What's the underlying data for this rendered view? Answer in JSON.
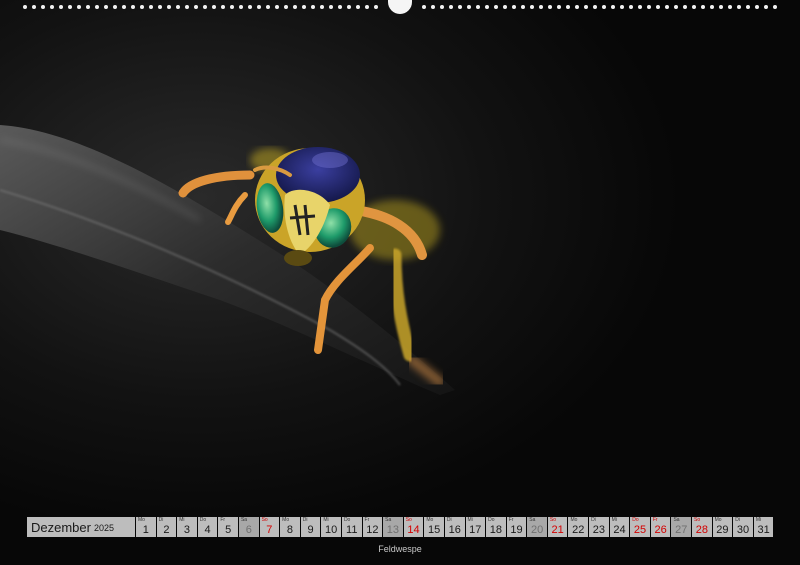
{
  "calendar": {
    "month": "Dezember",
    "year": "2025",
    "caption": "Feldwespe",
    "days": [
      {
        "wd": "Mo",
        "n": "1",
        "t": "w"
      },
      {
        "wd": "Di",
        "n": "2",
        "t": "w"
      },
      {
        "wd": "Mi",
        "n": "3",
        "t": "w"
      },
      {
        "wd": "Do",
        "n": "4",
        "t": "w"
      },
      {
        "wd": "Fr",
        "n": "5",
        "t": "w"
      },
      {
        "wd": "Sa",
        "n": "6",
        "t": "sat"
      },
      {
        "wd": "So",
        "n": "7",
        "t": "sun"
      },
      {
        "wd": "Mo",
        "n": "8",
        "t": "w"
      },
      {
        "wd": "Di",
        "n": "9",
        "t": "w"
      },
      {
        "wd": "Mi",
        "n": "10",
        "t": "w"
      },
      {
        "wd": "Do",
        "n": "11",
        "t": "w"
      },
      {
        "wd": "Fr",
        "n": "12",
        "t": "w"
      },
      {
        "wd": "Sa",
        "n": "13",
        "t": "sat"
      },
      {
        "wd": "So",
        "n": "14",
        "t": "sun"
      },
      {
        "wd": "Mo",
        "n": "15",
        "t": "w"
      },
      {
        "wd": "Di",
        "n": "16",
        "t": "w"
      },
      {
        "wd": "Mi",
        "n": "17",
        "t": "w"
      },
      {
        "wd": "Do",
        "n": "18",
        "t": "w"
      },
      {
        "wd": "Fr",
        "n": "19",
        "t": "w"
      },
      {
        "wd": "Sa",
        "n": "20",
        "t": "sat"
      },
      {
        "wd": "So",
        "n": "21",
        "t": "sun"
      },
      {
        "wd": "Mo",
        "n": "22",
        "t": "w"
      },
      {
        "wd": "Di",
        "n": "23",
        "t": "w"
      },
      {
        "wd": "Mi",
        "n": "24",
        "t": "w"
      },
      {
        "wd": "Do",
        "n": "25",
        "t": "hol"
      },
      {
        "wd": "Fr",
        "n": "26",
        "t": "hol"
      },
      {
        "wd": "Sa",
        "n": "27",
        "t": "sat"
      },
      {
        "wd": "So",
        "n": "28",
        "t": "sun"
      },
      {
        "wd": "Mo",
        "n": "29",
        "t": "w"
      },
      {
        "wd": "Di",
        "n": "30",
        "t": "w"
      },
      {
        "wd": "Mi",
        "n": "31",
        "t": "w"
      }
    ]
  },
  "colors": {
    "background": "#0b0b0b",
    "cell": "#bdbdbd",
    "holiday_red": "#d40000"
  },
  "photo": {
    "subject": "wasp-on-leaf"
  }
}
